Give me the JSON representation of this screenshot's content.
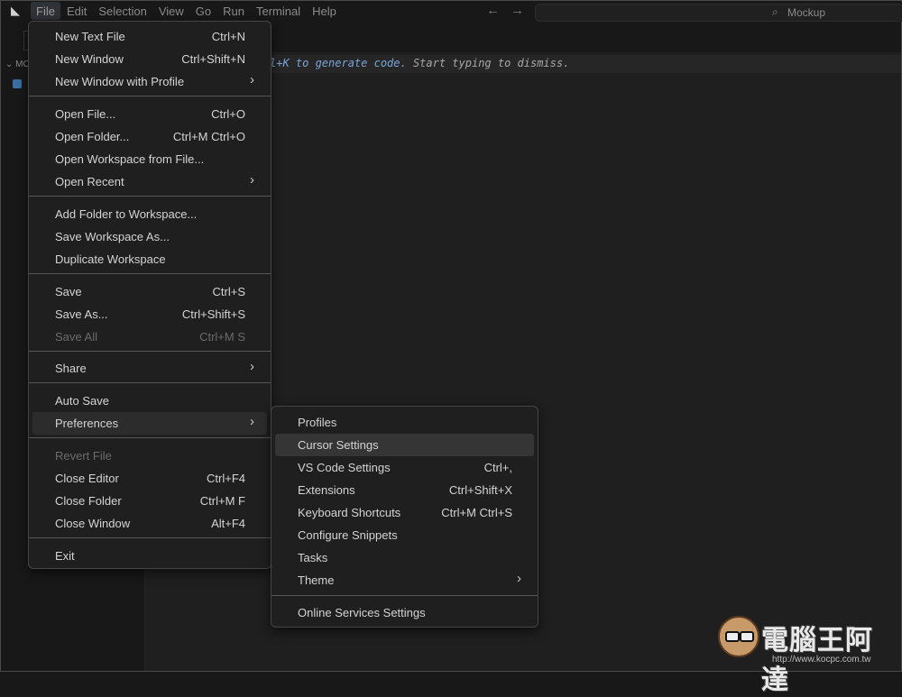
{
  "titlebar": {
    "menus": [
      "File",
      "Edit",
      "Selection",
      "View",
      "Go",
      "Run",
      "Terminal",
      "Help"
    ],
    "nav_back": "←",
    "nav_forward": "→",
    "search_text": "Mockup"
  },
  "sidebar": {
    "section_label": "MO"
  },
  "editor": {
    "hint_prefix": "l+K to generate code.",
    "hint_rest": " Start typing to dismiss."
  },
  "file_menu": {
    "items": [
      {
        "label": "New Text File",
        "shortcut": "Ctrl+N"
      },
      {
        "label": "New Window",
        "shortcut": "Ctrl+Shift+N"
      },
      {
        "label": "New Window with Profile",
        "shortcut": ""
      },
      {
        "label": "Open File...",
        "shortcut": "Ctrl+O"
      },
      {
        "label": "Open Folder...",
        "shortcut": "Ctrl+M Ctrl+O"
      },
      {
        "label": "Open Workspace from File...",
        "shortcut": ""
      },
      {
        "label": "Open Recent",
        "shortcut": ""
      },
      {
        "label": "Add Folder to Workspace...",
        "shortcut": ""
      },
      {
        "label": "Save Workspace As...",
        "shortcut": ""
      },
      {
        "label": "Duplicate Workspace",
        "shortcut": ""
      },
      {
        "label": "Save",
        "shortcut": "Ctrl+S"
      },
      {
        "label": "Save As...",
        "shortcut": "Ctrl+Shift+S"
      },
      {
        "label": "Save All",
        "shortcut": "Ctrl+M S"
      },
      {
        "label": "Share",
        "shortcut": ""
      },
      {
        "label": "Auto Save",
        "shortcut": ""
      },
      {
        "label": "Preferences",
        "shortcut": ""
      },
      {
        "label": "Revert File",
        "shortcut": ""
      },
      {
        "label": "Close Editor",
        "shortcut": "Ctrl+F4"
      },
      {
        "label": "Close Folder",
        "shortcut": "Ctrl+M F"
      },
      {
        "label": "Close Window",
        "shortcut": "Alt+F4"
      },
      {
        "label": "Exit",
        "shortcut": ""
      }
    ]
  },
  "preferences_menu": {
    "items": [
      {
        "label": "Profiles",
        "shortcut": ""
      },
      {
        "label": "Cursor Settings",
        "shortcut": ""
      },
      {
        "label": "VS Code Settings",
        "shortcut": "Ctrl+,"
      },
      {
        "label": "Extensions",
        "shortcut": "Ctrl+Shift+X"
      },
      {
        "label": "Keyboard Shortcuts",
        "shortcut": "Ctrl+M Ctrl+S"
      },
      {
        "label": "Configure Snippets",
        "shortcut": ""
      },
      {
        "label": "Tasks",
        "shortcut": ""
      },
      {
        "label": "Theme",
        "shortcut": ""
      },
      {
        "label": "Online Services Settings",
        "shortcut": ""
      }
    ]
  },
  "submenu_arrow": "›",
  "watermark": {
    "title": "電腦王阿達",
    "url": "http://www.kocpc.com.tw"
  },
  "colors": {
    "background": "#181818",
    "menu_background": "#1f1f1f",
    "highlight": "#2c2c2c",
    "hint_blue": "#7aa6d8"
  }
}
